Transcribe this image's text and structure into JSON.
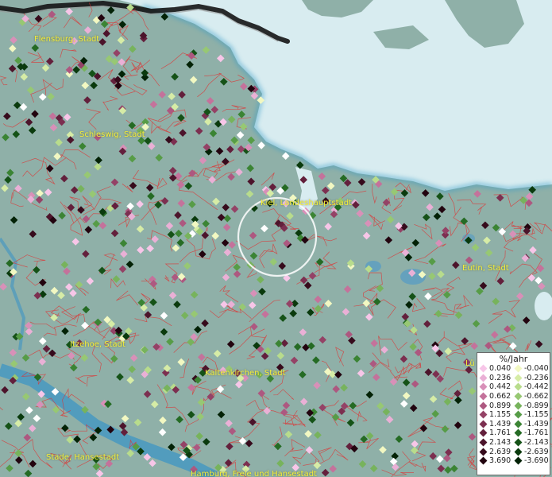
{
  "map": {
    "cities": [
      {
        "id": "flensburg",
        "label": "Flensburg, Stadt"
      },
      {
        "id": "schleswig",
        "label": "Schleswig, Stadt"
      },
      {
        "id": "kiel",
        "label": "Kiel, Landeshauptstadt"
      },
      {
        "id": "eutin",
        "label": "Eutin, Stadt"
      },
      {
        "id": "itzehoe",
        "label": "Itzehoe, Stadt"
      },
      {
        "id": "kaltenkirchen",
        "label": "Kaltenkirchen, Stadt"
      },
      {
        "id": "stade",
        "label": "Stade, Hansestadt"
      },
      {
        "id": "hamburg",
        "label": "Hamburg, Freie und Hansestadt"
      },
      {
        "id": "luebeck",
        "label": "Lü"
      }
    ],
    "colors": {
      "sea": "#d8ecf0",
      "land": "#8fb0a8",
      "boundary": "#e03030",
      "border": "#1a1a1a",
      "city_label": "#f4ef3a"
    }
  },
  "legend": {
    "title": "%/Jahr",
    "positive": [
      {
        "value": "0.040",
        "color": "#f7c6e8"
      },
      {
        "value": "0.236",
        "color": "#eab0d6"
      },
      {
        "value": "0.442",
        "color": "#d890b8"
      },
      {
        "value": "0.662",
        "color": "#c4729b"
      },
      {
        "value": "0.899",
        "color": "#ad5880"
      },
      {
        "value": "1.155",
        "color": "#944266"
      },
      {
        "value": "1.439",
        "color": "#7c2f50"
      },
      {
        "value": "1.761",
        "color": "#63203c"
      },
      {
        "value": "2.143",
        "color": "#4c142b"
      },
      {
        "value": "2.639",
        "color": "#360b1c"
      },
      {
        "value": "3.690",
        "color": "#22040f"
      }
    ],
    "negative": [
      {
        "value": "-0.040",
        "color": "#f2f8c2"
      },
      {
        "value": "-0.236",
        "color": "#d6eca6"
      },
      {
        "value": "-0.442",
        "color": "#b8dc8c"
      },
      {
        "value": "-0.662",
        "color": "#97c873"
      },
      {
        "value": "-0.899",
        "color": "#77b35c"
      },
      {
        "value": "-1.155",
        "color": "#579c47"
      },
      {
        "value": "-1.439",
        "color": "#3b8434"
      },
      {
        "value": "-1.761",
        "color": "#256b24"
      },
      {
        "value": "-2.143",
        "color": "#155217"
      },
      {
        "value": "-2.639",
        "color": "#0a3a0d"
      },
      {
        "value": "-3.690",
        "color": "#032206"
      }
    ]
  }
}
